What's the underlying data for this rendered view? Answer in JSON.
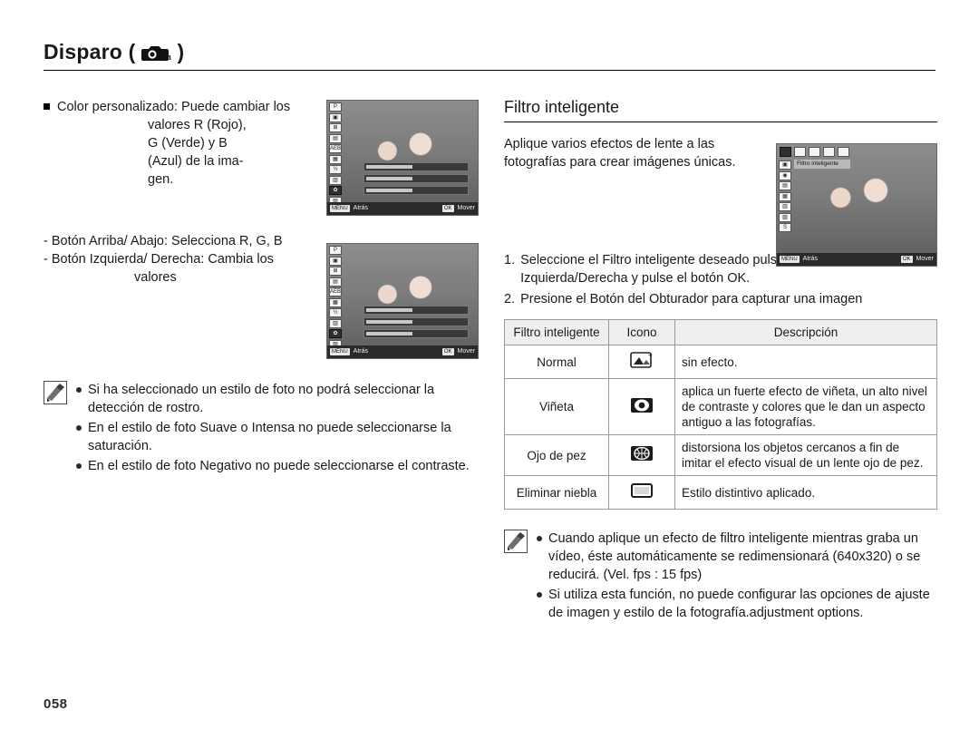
{
  "header": {
    "title": "Disparo (",
    "title_close": ")",
    "icon": "camera-mode-fn-icon"
  },
  "left": {
    "bullet1": {
      "line1": "Color personalizado: Puede cambiar los",
      "line2": "valores R (Rojo),",
      "line3": "G (Verde) y B",
      "line4": "(Azul) de la ima-",
      "line5": "gen."
    },
    "dashes": {
      "line1": "- Botón Arriba/ Abajo: Selecciona R, G, B",
      "line2": "- Botón Izquierda/ Derecha: Cambia los",
      "line3": "valores"
    },
    "notes": [
      "Si ha seleccionado un estilo de foto no podrá seleccionar la detección de rostro.",
      "En el estilo de foto Suave o Intensa no puede seleccionarse la saturación.",
      "En el estilo de foto Negativo no puede seleccionarse el contraste."
    ]
  },
  "right": {
    "section_title": "Filtro inteligente",
    "intro_line1": "Aplique varios efectos de lente a las",
    "intro_line2": "fotografías para crear imágenes únicas.",
    "steps": [
      {
        "n": "1.",
        "text": "Seleccione el Filtro inteligente deseado pulsando los botones Izquierda/Derecha y pulse el botón OK."
      },
      {
        "n": "2.",
        "text": "Presione el Botón del Obturador para capturar una imagen"
      }
    ],
    "table": {
      "headers": [
        "Filtro inteligente",
        "Icono",
        "Descripción"
      ],
      "rows": [
        {
          "name": "Normal",
          "icon": "normal-filter-icon",
          "desc": "sin efecto."
        },
        {
          "name": "Viñeta",
          "icon": "vignette-filter-icon",
          "desc": "aplica un fuerte efecto de viñeta, un alto nivel de contraste y colores que le dan un aspecto antiguo a las fotografías."
        },
        {
          "name": "Ojo de pez",
          "icon": "fisheye-filter-icon",
          "desc": "distorsiona los objetos cercanos a fin de imitar el efecto visual de un lente ojo de pez."
        },
        {
          "name": "Eliminar niebla",
          "icon": "defog-filter-icon",
          "desc": "Estilo distintivo aplicado."
        }
      ]
    },
    "notes": [
      "Cuando aplique un efecto de filtro inteligente mientras graba un vídeo, éste automáticamente se redimensionará (640x320) o se reducirá. (Vel. fps : 15 fps)",
      "Si utiliza esta función, no puede configurar las opciones de ajuste de imagen y estilo de la fotografía.adjustment options."
    ]
  },
  "screens": {
    "menu_title": "Filtro inteligente",
    "back_key": "MENU",
    "back_label": "Atrás",
    "move_key": "OK",
    "move_label": "Mover"
  },
  "page_number": "058"
}
